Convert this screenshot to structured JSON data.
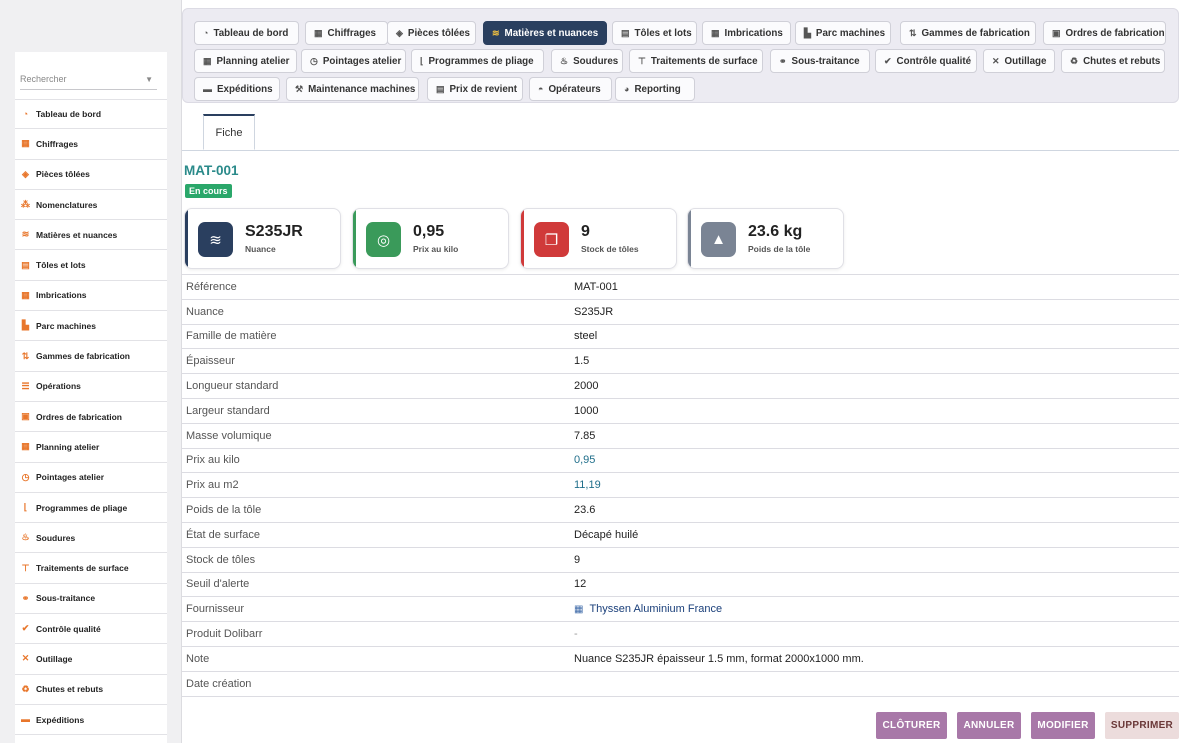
{
  "sidebar": {
    "search_placeholder": "Rechercher",
    "items": [
      {
        "label": "Tableau de bord",
        "icon": "gauge-icon",
        "glyph": "◔"
      },
      {
        "label": "Chiffrages",
        "icon": "calculator-icon",
        "glyph": "▦"
      },
      {
        "label": "Pièces tôlées",
        "icon": "cube-icon",
        "glyph": "◈"
      },
      {
        "label": "Nomenclatures",
        "icon": "sitemap-icon",
        "glyph": "⁂"
      },
      {
        "label": "Matières et nuances",
        "icon": "layers-icon",
        "glyph": "≋"
      },
      {
        "label": "Tôles et lots",
        "icon": "sheets-icon",
        "glyph": "▤"
      },
      {
        "label": "Imbrications",
        "icon": "grid-icon",
        "glyph": "▦"
      },
      {
        "label": "Parc machines",
        "icon": "industry-icon",
        "glyph": "▙"
      },
      {
        "label": "Gammes de fabrication",
        "icon": "flow-icon",
        "glyph": "⇅"
      },
      {
        "label": "Opérations",
        "icon": "list-icon",
        "glyph": "☰"
      },
      {
        "label": "Ordres de fabrication",
        "icon": "clipboard-icon",
        "glyph": "▣"
      },
      {
        "label": "Planning atelier",
        "icon": "calendar-icon",
        "glyph": "▦"
      },
      {
        "label": "Pointages atelier",
        "icon": "clock-icon",
        "glyph": "◷"
      },
      {
        "label": "Programmes de pliage",
        "icon": "bend-icon",
        "glyph": "⌊"
      },
      {
        "label": "Soudures",
        "icon": "flame-icon",
        "glyph": "♨"
      },
      {
        "label": "Traitements de surface",
        "icon": "paint-roller-icon",
        "glyph": "⊤"
      },
      {
        "label": "Sous-traitance",
        "icon": "handshake-icon",
        "glyph": "⚭"
      },
      {
        "label": "Contrôle qualité",
        "icon": "check-double-icon",
        "glyph": "✔"
      },
      {
        "label": "Outillage",
        "icon": "tools-icon",
        "glyph": "✕"
      },
      {
        "label": "Chutes et rebuts",
        "icon": "recycle-icon",
        "glyph": "♻"
      },
      {
        "label": "Expéditions",
        "icon": "truck-icon",
        "glyph": "▬"
      }
    ]
  },
  "tabs": [
    {
      "label": "Tableau de bord",
      "icon": "gauge-icon",
      "glyph": "◔"
    },
    {
      "label": "Chiffrages",
      "icon": "calculator-icon",
      "glyph": "▦"
    },
    {
      "label": "Pièces tôlées",
      "icon": "cube-icon",
      "glyph": "◈"
    },
    {
      "label": "Matières et nuances",
      "icon": "layers-icon",
      "glyph": "≋",
      "active": true
    },
    {
      "label": "Tôles et lots",
      "icon": "sheets-icon",
      "glyph": "▤"
    },
    {
      "label": "Imbrications",
      "icon": "grid-icon",
      "glyph": "▦"
    },
    {
      "label": "Parc machines",
      "icon": "industry-icon",
      "glyph": "▙"
    },
    {
      "label": "Gammes de fabrication",
      "icon": "flow-icon",
      "glyph": "⇅"
    },
    {
      "label": "Ordres de fabrication",
      "icon": "clipboard-icon",
      "glyph": "▣"
    },
    {
      "label": "Planning atelier",
      "icon": "calendar-icon",
      "glyph": "▦"
    },
    {
      "label": "Pointages atelier",
      "icon": "clock-icon",
      "glyph": "◷"
    },
    {
      "label": "Programmes de pliage",
      "icon": "bend-icon",
      "glyph": "⌊"
    },
    {
      "label": "Soudures",
      "icon": "flame-icon",
      "glyph": "♨"
    },
    {
      "label": "Traitements de surface",
      "icon": "paint-roller-icon",
      "glyph": "⊤"
    },
    {
      "label": "Sous-traitance",
      "icon": "handshake-icon",
      "glyph": "⚭"
    },
    {
      "label": "Contrôle qualité",
      "icon": "check-double-icon",
      "glyph": "✔"
    },
    {
      "label": "Outillage",
      "icon": "tools-icon",
      "glyph": "✕"
    },
    {
      "label": "Chutes et rebuts",
      "icon": "recycle-icon",
      "glyph": "♻"
    },
    {
      "label": "Expéditions",
      "icon": "truck-icon",
      "glyph": "▬"
    },
    {
      "label": "Maintenance machines",
      "icon": "wrench-icon",
      "glyph": "⚒"
    },
    {
      "label": "Prix de revient",
      "icon": "receipt-icon",
      "glyph": "▤"
    },
    {
      "label": "Opérateurs",
      "icon": "hard-hat-icon",
      "glyph": "◓"
    },
    {
      "label": "Reporting",
      "icon": "chart-pie-icon",
      "glyph": "◕"
    }
  ],
  "record": {
    "tab_label": "Fiche",
    "reference": "MAT-001",
    "status": "En cours"
  },
  "cards": [
    {
      "value": "S235JR",
      "label": "Nuance",
      "icon": "layers-icon",
      "glyph": "≋",
      "color": "#2a3f5f"
    },
    {
      "value": "0,95",
      "label": "Prix au kilo",
      "icon": "coins-icon",
      "glyph": "◎",
      "color": "#3a9a5a"
    },
    {
      "value": "9",
      "label": "Stock de tôles",
      "icon": "clone-icon",
      "glyph": "❐",
      "color": "#d03a3a"
    },
    {
      "value": "23.6 kg",
      "label": "Poids de la tôle",
      "icon": "weight-icon",
      "glyph": "▲",
      "color": "#7a8494"
    }
  ],
  "fields": [
    {
      "label": "Référence",
      "value": "MAT-001",
      "style": ""
    },
    {
      "label": "Nuance",
      "value": "S235JR",
      "style": ""
    },
    {
      "label": "Famille de matière",
      "value": "steel",
      "style": ""
    },
    {
      "label": "Épaisseur",
      "value": "1.5",
      "style": ""
    },
    {
      "label": "Longueur standard",
      "value": "2000",
      "style": ""
    },
    {
      "label": "Largeur standard",
      "value": "1000",
      "style": ""
    },
    {
      "label": "Masse volumique",
      "value": "7.85",
      "style": ""
    },
    {
      "label": "Prix au kilo",
      "value": "0,95",
      "style": "link"
    },
    {
      "label": "Prix au m2",
      "value": "11,19",
      "style": "link"
    },
    {
      "label": "Poids de la tôle",
      "value": "23.6",
      "style": ""
    },
    {
      "label": "État de surface",
      "value": "Décapé huilé",
      "style": ""
    },
    {
      "label": "Stock de tôles",
      "value": "9",
      "style": ""
    },
    {
      "label": "Seuil d'alerte",
      "value": "12",
      "style": ""
    },
    {
      "label": "Fournisseur",
      "value": "Thyssen Aluminium France",
      "style": "company"
    },
    {
      "label": "Produit Dolibarr",
      "value": "-",
      "style": "muted"
    },
    {
      "label": "Note",
      "value": "Nuance S235JR épaisseur 1.5 mm, format 2000x1000 mm.",
      "style": ""
    },
    {
      "label": "Date création",
      "value": "",
      "style": ""
    }
  ],
  "actions": {
    "close": "CLÔTURER",
    "cancel": "ANNULER",
    "edit": "MODIFIER",
    "delete": "SUPPRIMER"
  }
}
